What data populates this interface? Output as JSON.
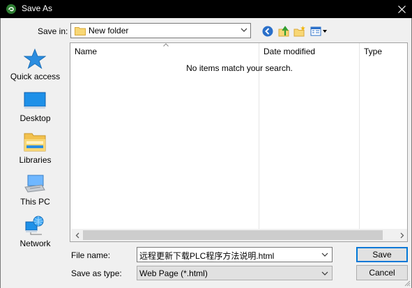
{
  "window": {
    "title": "Save As",
    "app_icon": "app-icon",
    "close_icon": "close-icon"
  },
  "toolbar": {
    "save_in_label": "Save in:",
    "save_in_value": "New folder",
    "icons": [
      "back-icon",
      "up-folder-icon",
      "new-folder-icon",
      "view-menu-icon"
    ]
  },
  "places": [
    {
      "label": "Quick access",
      "icon": "quick-access-icon"
    },
    {
      "label": "Desktop",
      "icon": "desktop-icon"
    },
    {
      "label": "Libraries",
      "icon": "libraries-icon"
    },
    {
      "label": "This PC",
      "icon": "this-pc-icon"
    },
    {
      "label": "Network",
      "icon": "network-icon"
    }
  ],
  "list": {
    "columns": [
      "Name",
      "Date modified",
      "Type"
    ],
    "empty_message": "No items match your search."
  },
  "fields": {
    "file_name_label": "File name:",
    "file_name_value": "远程更新下载PLC程序方法说明.html",
    "save_as_type_label": "Save as type:",
    "save_as_type_value": "Web Page (*.html)"
  },
  "buttons": {
    "save": "Save",
    "cancel": "Cancel"
  },
  "colors": {
    "title_bar": "#000000",
    "dialog_bg": "#f0f0f0",
    "accent": "#0078d7"
  }
}
